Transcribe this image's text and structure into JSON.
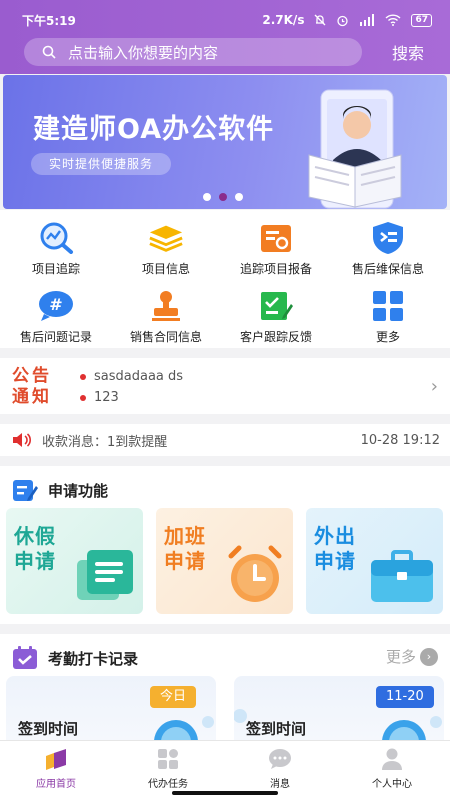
{
  "status_bar": {
    "time": "下午5:19",
    "network_speed": "2.7K/s",
    "battery": "67"
  },
  "search": {
    "placeholder": "点击输入你想要的内容",
    "button_label": "搜索"
  },
  "banner": {
    "title": "建造师OA办公软件",
    "subtitle": "实时提供便捷服务",
    "active_dot_index": 1
  },
  "grid": [
    {
      "label": "项目追踪",
      "icon": "chart-magnifier-icon"
    },
    {
      "label": "项目信息",
      "icon": "layers-icon"
    },
    {
      "label": "追踪项目报备",
      "icon": "report-folder-icon"
    },
    {
      "label": "售后维保信息",
      "icon": "shield-tool-icon"
    },
    {
      "label": "售后问题记录",
      "icon": "hash-chat-icon"
    },
    {
      "label": "销售合同信息",
      "icon": "stamp-icon"
    },
    {
      "label": "客户跟踪反馈",
      "icon": "edit-form-icon"
    },
    {
      "label": "更多",
      "icon": "grid-more-icon"
    }
  ],
  "notice": {
    "tag_line1": "公告",
    "tag_line2": "通知",
    "items": [
      "sasdadaaa ds",
      "123"
    ]
  },
  "message": {
    "text": "收款消息：1到款提醒",
    "time": "10-28 19:12"
  },
  "apply": {
    "title": "申请功能",
    "cards": [
      {
        "line1": "休假",
        "line2": "申请",
        "color": "#1ea795"
      },
      {
        "line1": "加班",
        "line2": "申请",
        "color": "#f07e22"
      },
      {
        "line1": "外出",
        "line2": "申请",
        "color": "#1a8de0"
      }
    ]
  },
  "attendance": {
    "title": "考勤打卡记录",
    "more_label": "更多",
    "cards": [
      {
        "label": "签到时间",
        "badge": "今日",
        "badge_color": "#f5a623"
      },
      {
        "label": "签到时间",
        "badge": "11-20",
        "badge_color": "#2f6de0"
      }
    ]
  },
  "tabbar": [
    {
      "label": "应用首页",
      "icon": "app-home-icon",
      "active": true
    },
    {
      "label": "代办任务",
      "icon": "tasks-icon",
      "active": false
    },
    {
      "label": "消息",
      "icon": "chat-bubble-icon",
      "active": false
    },
    {
      "label": "个人中心",
      "icon": "person-icon",
      "active": false
    }
  ],
  "colors": {
    "header": "#a065d2",
    "accent": "#8b3aa6",
    "notice_red": "#e04c2c"
  }
}
